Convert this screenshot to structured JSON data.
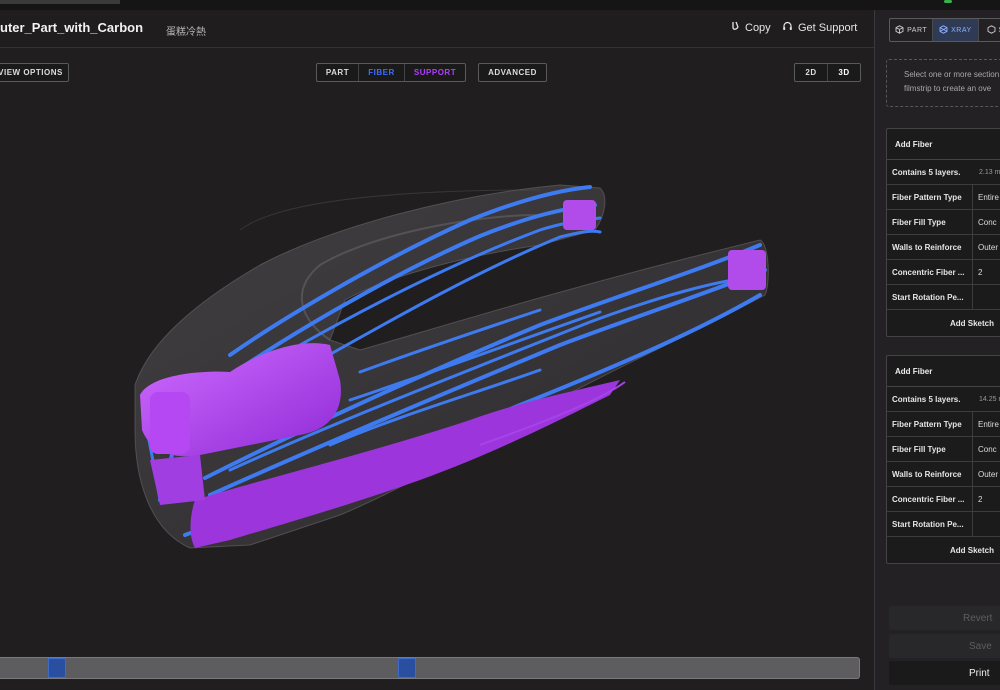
{
  "header": {
    "title": "uter_Part_with_Carbon",
    "material": "蛋糕冷熱",
    "copy_label": "Copy",
    "support_label": "Get Support"
  },
  "toolbar": {
    "view_options": "VIEW OPTIONS",
    "modes": [
      "PART",
      "FIBER",
      "SUPPORT"
    ],
    "advanced": "ADVANCED",
    "dimensions": [
      "2D",
      "3D"
    ]
  },
  "colors": {
    "fiber": "#3d6bff",
    "support": "#b13cff",
    "fiber_path": "#3f7bf0",
    "support_mesh": "#a13ae6"
  },
  "right_panel": {
    "tabs": [
      "PART",
      "XRAY",
      "S"
    ],
    "active_tab": "XRAY",
    "info_lines": [
      "Select one or more section",
      "filmstrip to create an ove"
    ],
    "fibers": [
      {
        "header": "Add Fiber",
        "summary_label": "Contains 5 layers.",
        "summary_value": "2.13 m",
        "rows": [
          {
            "label": "Fiber Pattern Type",
            "value": "Entire"
          },
          {
            "label": "Fiber Fill Type",
            "value": "Conc"
          },
          {
            "label": "Walls to Reinforce",
            "value": "Outer"
          },
          {
            "label": "Concentric Fiber ...",
            "value": "2"
          },
          {
            "label": "Start Rotation Pe...",
            "value": ""
          }
        ],
        "footer": "Add Sketch"
      },
      {
        "header": "Add Fiber",
        "summary_label": "Contains 5 layers.",
        "summary_value": "14.25 m",
        "rows": [
          {
            "label": "Fiber Pattern Type",
            "value": "Entire"
          },
          {
            "label": "Fiber Fill Type",
            "value": "Conc"
          },
          {
            "label": "Walls to Reinforce",
            "value": "Outer"
          },
          {
            "label": "Concentric Fiber ...",
            "value": "2"
          },
          {
            "label": "Start Rotation Pe...",
            "value": ""
          }
        ],
        "footer": "Add Sketch"
      }
    ],
    "actions": {
      "revert": "Revert",
      "save": "Save",
      "print": "Print"
    }
  }
}
